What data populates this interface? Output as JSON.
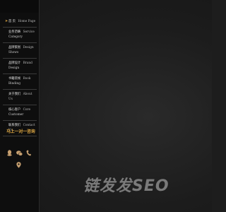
{
  "sidebar": {
    "items": [
      {
        "zh": "首 页",
        "en": "Home Page",
        "active": true
      },
      {
        "zh": "业务范畴",
        "en": "Service",
        "en2": "Category"
      },
      {
        "zh": "品牌策划",
        "en": "Design",
        "en2": "Shows"
      },
      {
        "zh": "品牌设计",
        "en": "Brand",
        "en2": "Design"
      },
      {
        "zh": "书籍装帧",
        "en": "Book",
        "en2": "Binding"
      },
      {
        "zh": "关于我们",
        "en": "About Us"
      },
      {
        "zh": "核心客户",
        "en": "Core",
        "en2": "Customer"
      },
      {
        "zh": "联系我们",
        "en": "Contact Us"
      }
    ],
    "cta_label": "马上一对一咨询",
    "icons": [
      "qq-icon",
      "wechat-icon",
      "phone-icon",
      "location-icon"
    ],
    "accent_color": "#d9a441"
  },
  "watermark": "链发发SEO"
}
